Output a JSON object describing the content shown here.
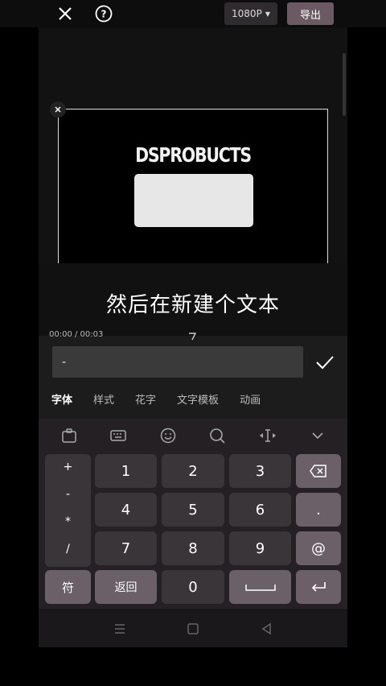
{
  "topbar": {
    "resolution": "1080P",
    "export_label": "导出"
  },
  "preview": {
    "brand": "DSPROBUCTS"
  },
  "subtitle": {
    "text": "然后在新建个文本"
  },
  "timeline": {
    "time": "00:00 / 00:03"
  },
  "editor": {
    "input_value": "-",
    "tabs": [
      "字体",
      "样式",
      "花字",
      "文字模板",
      "动画"
    ]
  },
  "keyboard": {
    "symbols": [
      "+",
      "-",
      "*",
      "/"
    ],
    "digits": [
      "1",
      "2",
      "3",
      "4",
      "5",
      "6",
      "7",
      "8",
      "9",
      "0"
    ],
    "dot": ".",
    "at": "@",
    "fu": "符",
    "back": "返回"
  },
  "colors": {
    "accent": "#6b5a64",
    "bg": "#121212"
  }
}
